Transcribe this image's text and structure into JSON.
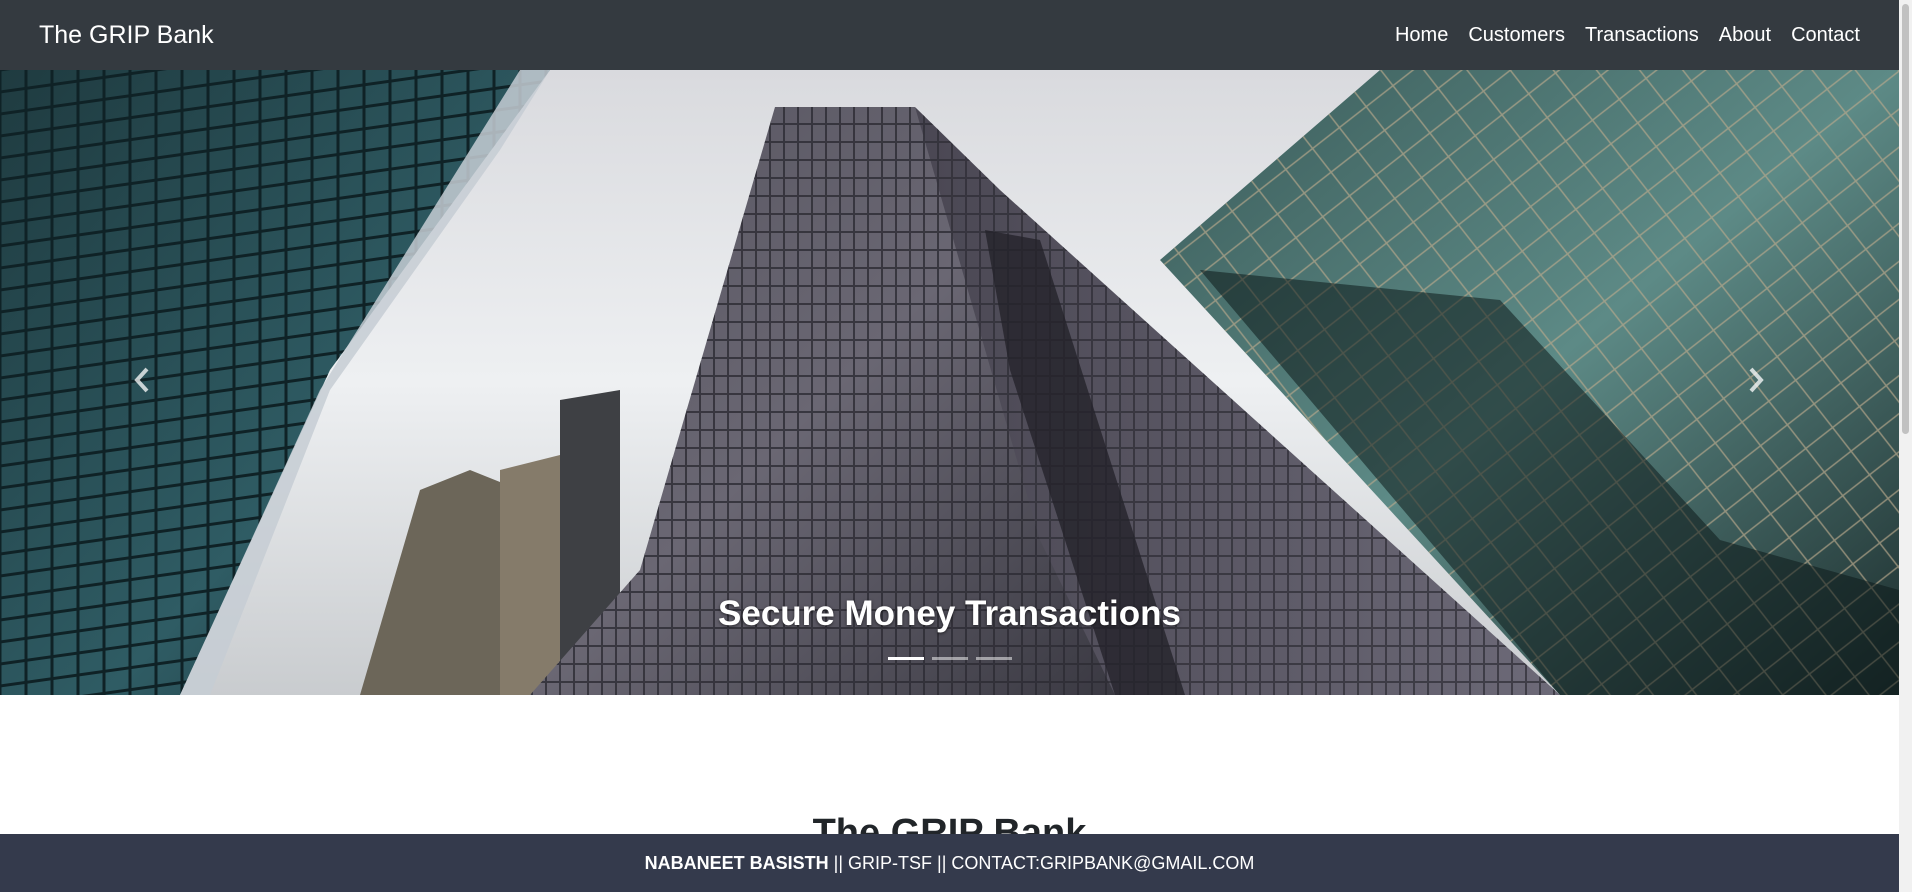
{
  "navbar": {
    "brand": "The GRIP Bank",
    "links": [
      "Home",
      "Customers",
      "Transactions",
      "About",
      "Contact"
    ]
  },
  "carousel": {
    "caption": "Secure Money Transactions",
    "slide_count": 3,
    "active_slide": 0,
    "prev_icon": "chevron-left-icon",
    "next_icon": "chevron-right-icon"
  },
  "section": {
    "title": "The GRIP Bank"
  },
  "footer": {
    "name": "NABANEET BASISTH",
    "sep1": " || ",
    "org": "GRIP-TSF",
    "sep2": " || ",
    "contact": "CONTACT:GRIPBANK@GMAIL.COM"
  },
  "colors": {
    "navbar_bg": "#343a40",
    "footer_bg": "#343a4c"
  }
}
